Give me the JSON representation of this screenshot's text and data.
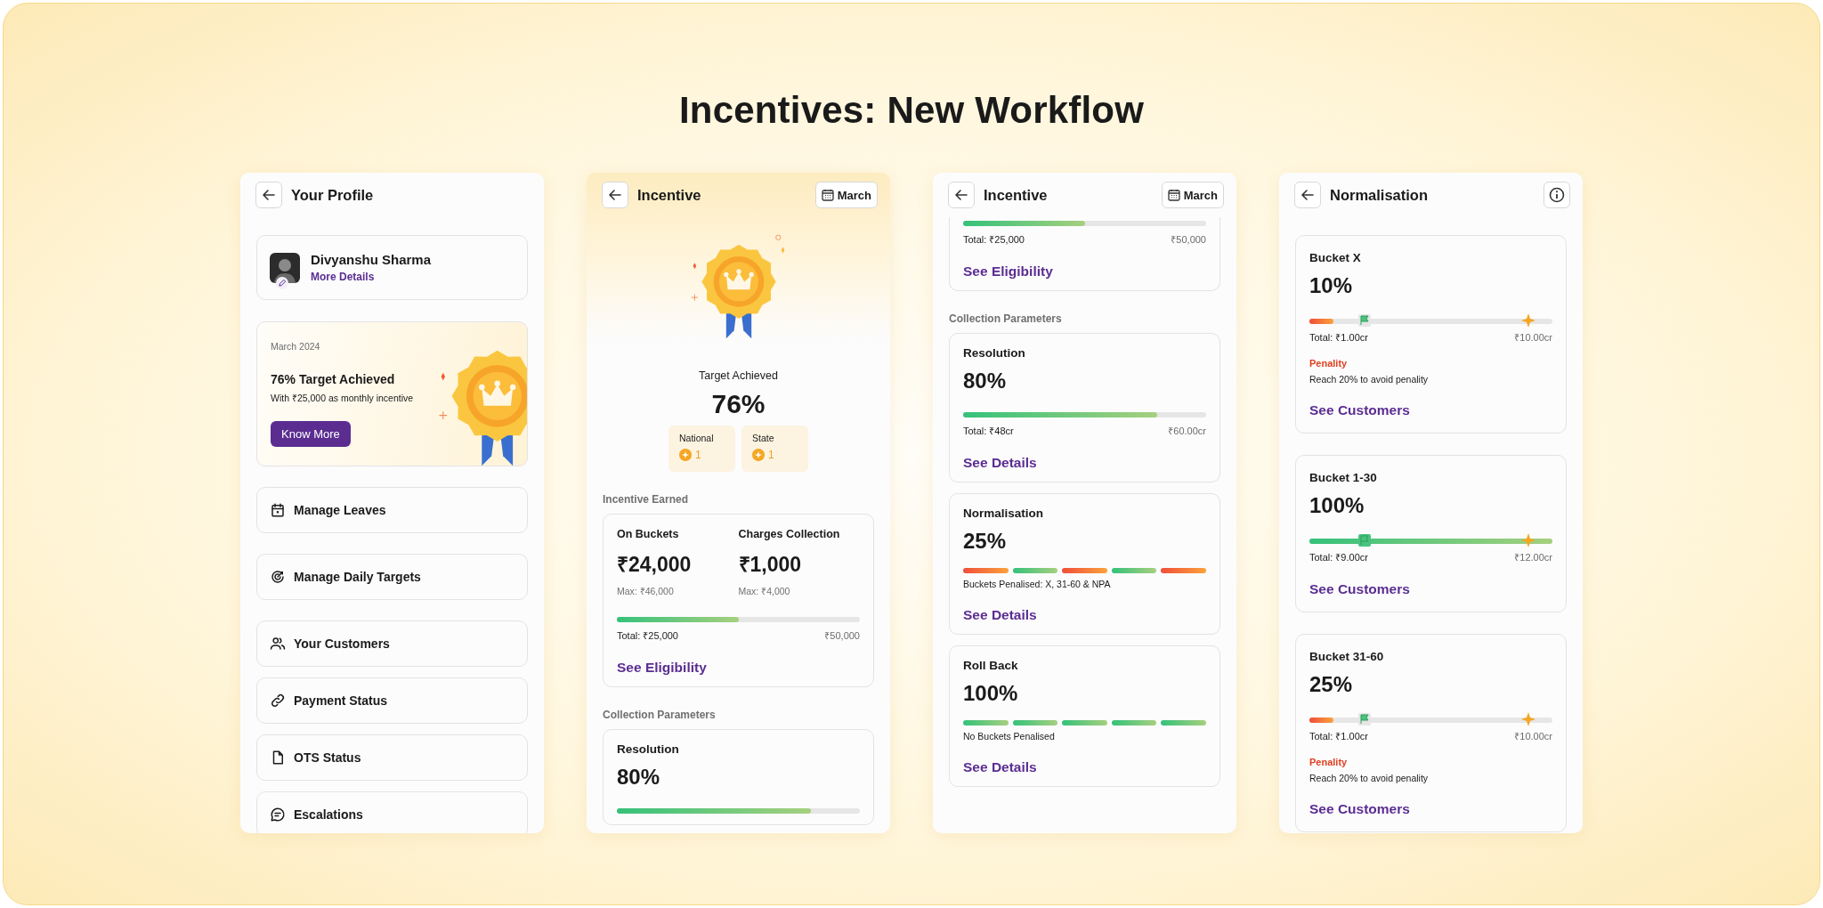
{
  "title": "Incentives: New Workflow",
  "screens": [
    {
      "title": "Your Profile",
      "blocks": [
        {
          "kind": "profile",
          "name": "Divyanshu Sharma",
          "link": "More Details"
        },
        {
          "kind": "banner",
          "period": "March 2024",
          "headline": "76% Target Achieved",
          "subtext": "With ₹25,000 as monthly incentive",
          "button": "Know More"
        },
        {
          "kind": "menu",
          "groups": [
            [
              {
                "label": "Manage Leaves",
                "kind": "calendar"
              }
            ],
            [
              {
                "label": "Manage Daily Targets",
                "kind": "target"
              }
            ],
            [
              {
                "label": "Your Customers",
                "kind": "people"
              },
              {
                "label": "Payment Status",
                "kind": "link"
              },
              {
                "label": "OTS Status",
                "kind": "document"
              },
              {
                "label": "Escalations",
                "kind": "chat"
              }
            ]
          ]
        }
      ]
    },
    {
      "title": "Incentive",
      "action": {
        "kind": "month",
        "label": "March"
      },
      "blocks": [
        {
          "kind": "hero",
          "caption": "Target Achieved",
          "value": "76%",
          "ranks": [
            {
              "label": "National",
              "value": "1"
            },
            {
              "label": "State",
              "value": "1"
            }
          ]
        },
        {
          "kind": "section",
          "label": "Incentive Earned"
        },
        {
          "kind": "earned",
          "items": [
            {
              "label": "On Buckets",
              "value": "₹24,000",
              "max": "Max: ₹46,000"
            },
            {
              "label": "Charges Collection",
              "value": "₹1,000",
              "max": "Max: ₹4,000"
            }
          ],
          "level": 0.5,
          "total": "Total: ₹25,000",
          "max": "₹50,000",
          "link": "See Eligibility"
        },
        {
          "kind": "section",
          "label": "Collection Parameters"
        },
        {
          "kind": "progress",
          "label": "Resolution",
          "value": "80%",
          "level": 0.8
        }
      ]
    },
    {
      "title": "Incentive",
      "action": {
        "kind": "month",
        "label": "March"
      },
      "blocks": [
        {
          "kind": "tail",
          "level": 0.5,
          "total": "Total: ₹25,000",
          "max": "₹50,000",
          "link": "See Eligibility"
        },
        {
          "kind": "section",
          "label": "Collection Parameters"
        },
        {
          "kind": "progress",
          "label": "Resolution",
          "value": "80%",
          "level": 0.8,
          "total": "Total: ₹48cr",
          "max": "₹60.00cr",
          "link": "See Details"
        },
        {
          "kind": "segments",
          "label": "Normalisation",
          "value": "25%",
          "segments": [
            {
              "penalised": true
            },
            {
              "penalised": false
            },
            {
              "penalised": true
            },
            {
              "penalised": false
            },
            {
              "penalised": true
            }
          ],
          "note": "Buckets Penalised: X, 31-60 & NPA",
          "link": "See Details"
        },
        {
          "kind": "segments",
          "label": "Roll Back",
          "value": "100%",
          "segments": [
            {
              "penalised": false
            },
            {
              "penalised": false
            },
            {
              "penalised": false
            },
            {
              "penalised": false
            },
            {
              "penalised": false
            }
          ],
          "note": "No Buckets Penalised",
          "link": "See Details"
        }
      ]
    },
    {
      "title": "Normalisation",
      "action": {
        "kind": "info"
      },
      "blocks": [
        {
          "kind": "bucket",
          "label": "Bucket X",
          "value": "10%",
          "level": 0.1,
          "penalised": true,
          "total": "Total: ₹1.00cr",
          "max": "₹10.00cr",
          "penalty": {
            "label": "Penality",
            "note": "Reach 20% to avoid penality"
          },
          "link": "See Customers"
        },
        {
          "kind": "bucket",
          "label": "Bucket 1-30",
          "value": "100%",
          "level": 1,
          "penalised": false,
          "total": "Total: ₹9.00cr",
          "max": "₹12.00cr",
          "link": "See Customers"
        },
        {
          "kind": "bucket",
          "label": "Bucket 31-60",
          "value": "25%",
          "level": 0.1,
          "penalised": true,
          "total": "Total: ₹1.00cr",
          "max": "₹10.00cr",
          "penalty": {
            "label": "Penality",
            "note": "Reach 20% to avoid penality"
          },
          "link": "See Customers"
        }
      ]
    }
  ]
}
